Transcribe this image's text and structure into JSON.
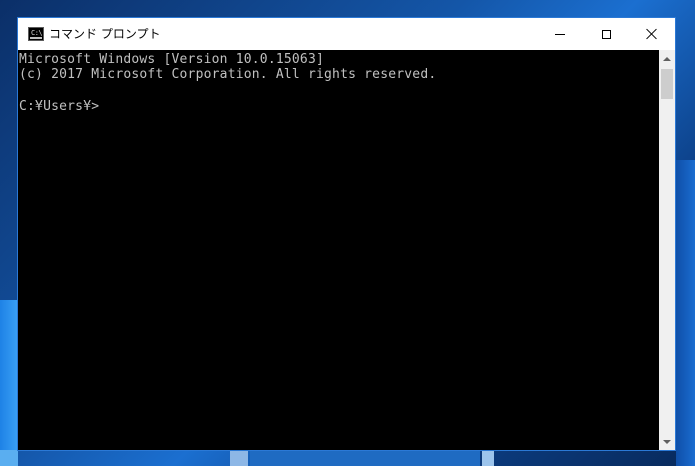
{
  "window": {
    "title": "コマンド プロンプト",
    "icon": "cmd-icon",
    "icon_text": "C:\\"
  },
  "controls": {
    "minimize_icon": "minimize-icon",
    "maximize_icon": "maximize-icon",
    "close_icon": "close-icon"
  },
  "console": {
    "background": "#000000",
    "text_color": "#c0c0c0",
    "lines": [
      "Microsoft Windows [Version 10.0.15063]",
      "(c) 2017 Microsoft Corporation. All rights reserved.",
      "C:¥Users¥>"
    ]
  },
  "scrollbar": {
    "up_icon": "scroll-up-arrow-icon",
    "down_icon": "scroll-down-arrow-icon"
  }
}
